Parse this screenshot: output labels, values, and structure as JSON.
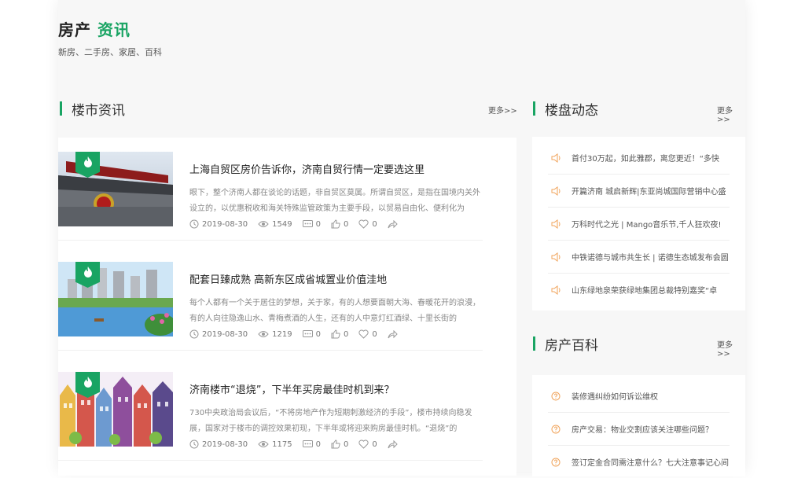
{
  "header": {
    "brand_part1": "房产",
    "brand_part2": "资讯",
    "subtitle": "新房、二手房、家居、百科"
  },
  "sections": {
    "market": {
      "title": "楼市资讯",
      "more": "更多>>"
    },
    "property": {
      "title": "楼盘动态",
      "more": "更多>>"
    },
    "encyclopedia": {
      "title": "房产百科",
      "more": "更多>>"
    }
  },
  "news": [
    {
      "title": "上海自贸区房价告诉你，济南自贸行情一定要选这里",
      "desc": "眼下，整个济南人都在谈论的话题，非自贸区莫属。所谓自贸区，是指在国境内关外设立的，以优惠税收和海关特殊监管政策为主要手段，以贸易自由化、便利化为",
      "date": "2019-08-30",
      "views": "1549",
      "comments": "0",
      "likes": "0",
      "favorites": "0"
    },
    {
      "title": "配套日臻成熟 高新东区成省城置业价值洼地",
      "desc": "每个人都有一个关于居住的梦想，关于家，有的人想要面朝大海、春暖花开的浪漫，有的人向往隐逸山水、青梅煮酒的人生，还有的人中意灯红酒绿、十里长街的",
      "date": "2019-08-30",
      "views": "1219",
      "comments": "0",
      "likes": "0",
      "favorites": "0"
    },
    {
      "title": "济南楼市“退烧”，下半年买房最佳时机到来？",
      "desc": "730中央政治局会议后，“不将房地产作为短期刺激经济的手段”，楼市持续向稳发展，国家对于楼市的调控效果初现，下半年或将迎来购房最佳时机。“退烧”的",
      "date": "2019-08-30",
      "views": "1175",
      "comments": "0",
      "likes": "0",
      "favorites": "0"
    }
  ],
  "property_list": [
    "首付30万起，如此雅郡，离您更近！“多快",
    "开篇济南 城启新辉|东亚尚城国际营销中心盛",
    "万科时代之光 | Mango音乐节,千人狂欢夜!",
    "中铁诺德与城市共生长 | 诺德生态城发布会圆",
    "山东绿地泉荣获绿地集团总裁特别嘉奖“卓"
  ],
  "encyclopedia_list": [
    "装修遇纠纷如何诉讼维权",
    "房产交易：物业交割应该关注哪些问题？",
    "签订定金合同需注意什么？七大注意事记心间"
  ],
  "colors": {
    "accent": "#19a463",
    "speaker": "#f0a35a",
    "question": "#f0a35a"
  }
}
